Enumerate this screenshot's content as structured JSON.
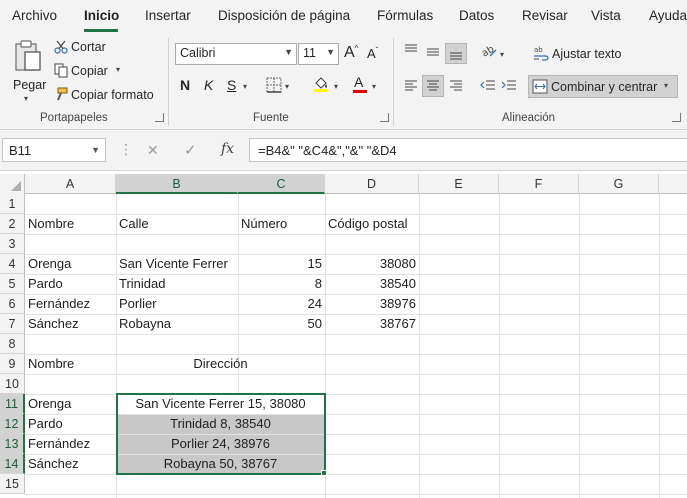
{
  "tabs": [
    "Archivo",
    "Inicio",
    "Insertar",
    "Disposición de página",
    "Fórmulas",
    "Datos",
    "Revisar",
    "Vista",
    "Ayuda"
  ],
  "ribbon": {
    "portapapeles": {
      "paste_label": "Pegar",
      "cut_label": "Cortar",
      "copy_label": "Copiar",
      "format_label": "Copiar formato",
      "group_label": "Portapapeles"
    },
    "fuente": {
      "font_name": "Calibri",
      "font_size": "11",
      "bold": "N",
      "italic": "K",
      "underline": "S",
      "font_color": "A",
      "grow": "A",
      "shrink": "A",
      "group_label": "Fuente",
      "highlight_color": "#ffff00",
      "font_color_hex": "#e00000"
    },
    "alineacion": {
      "wrap_label": "Ajustar texto",
      "merge_label": "Combinar y centrar",
      "group_label": "Alineación"
    }
  },
  "formula_bar": {
    "name_box": "B11",
    "cancel_icon": "✕",
    "enter_icon": "✓",
    "fx": "fx",
    "formula": "=B4&\" \"&C4&\",\"&\" \"&D4"
  },
  "grid": {
    "columns": [
      "A",
      "B",
      "C",
      "D",
      "E",
      "F",
      "G"
    ],
    "rows": [
      "1",
      "2",
      "3",
      "4",
      "5",
      "6",
      "7",
      "8",
      "9",
      "10",
      "11",
      "12",
      "13",
      "14",
      "15"
    ],
    "headers": {
      "nombre": "Nombre",
      "calle": "Calle",
      "numero": "Número",
      "codigo": "Código postal"
    },
    "data": [
      {
        "nombre": "Orenga",
        "calle": "San Vicente Ferrer",
        "numero": "15",
        "codigo": "38080"
      },
      {
        "nombre": "Pardo",
        "calle": "Trinidad",
        "numero": "8",
        "codigo": "38540"
      },
      {
        "nombre": "Fernández",
        "calle": "Porlier",
        "numero": "24",
        "codigo": "38976"
      },
      {
        "nombre": "Sánchez",
        "calle": "Robayna",
        "numero": "50",
        "codigo": "38767"
      }
    ],
    "section2": {
      "nombre_header": "Nombre",
      "direccion_header": "Dirección"
    },
    "results": [
      {
        "nombre": "Orenga",
        "direccion": "San Vicente Ferrer 15, 38080"
      },
      {
        "nombre": "Pardo",
        "direccion": "Trinidad 8, 38540"
      },
      {
        "nombre": "Fernández",
        "direccion": "Porlier 24, 38976"
      },
      {
        "nombre": "Sánchez",
        "direccion": "Robayna 50, 38767"
      }
    ]
  },
  "colors": {
    "accent": "#217346",
    "selection": "#c8c8c8"
  }
}
